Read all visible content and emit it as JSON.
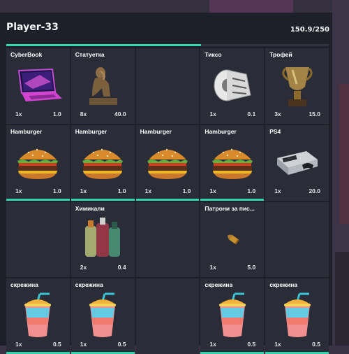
{
  "inventory": {
    "title": "Player-33",
    "weight_text": "150.9/250",
    "weight_fraction": 0.6036
  },
  "colors": {
    "accent": "#30d9b2",
    "slot": "#2a2d38",
    "panel": "#1e2029"
  },
  "slots": [
    {
      "name": "CyberBook",
      "count": "1x",
      "weight": "1.0",
      "icon": "laptop-icon",
      "bar": false
    },
    {
      "name": "Статуетка",
      "count": "8x",
      "weight": "40.0",
      "icon": "statue-icon",
      "bar": false
    },
    {
      "name": "",
      "count": "",
      "weight": "",
      "icon": "",
      "bar": false
    },
    {
      "name": "Тиксо",
      "count": "1x",
      "weight": "0.1",
      "icon": "tape-icon",
      "bar": false
    },
    {
      "name": "Трофей",
      "count": "3x",
      "weight": "15.0",
      "icon": "trophy-icon",
      "bar": false
    },
    {
      "name": "Hamburger",
      "count": "1x",
      "weight": "1.0",
      "icon": "burger-icon",
      "bar": true
    },
    {
      "name": "Hamburger",
      "count": "1x",
      "weight": "1.0",
      "icon": "burger-icon",
      "bar": true
    },
    {
      "name": "Hamburger",
      "count": "1x",
      "weight": "1.0",
      "icon": "burger-icon",
      "bar": true
    },
    {
      "name": "Hamburger",
      "count": "1x",
      "weight": "1.0",
      "icon": "burger-icon",
      "bar": true
    },
    {
      "name": "PS4",
      "count": "1x",
      "weight": "20.0",
      "icon": "console-icon",
      "bar": false
    },
    {
      "name": "",
      "count": "",
      "weight": "",
      "icon": "",
      "bar": false
    },
    {
      "name": "Химикали",
      "count": "2x",
      "weight": "0.4",
      "icon": "chemicals-icon",
      "bar": false
    },
    {
      "name": "",
      "count": "",
      "weight": "",
      "icon": "",
      "bar": false
    },
    {
      "name": "Патрони за пис...",
      "count": "1x",
      "weight": "5.0",
      "icon": "bullet-icon",
      "bar": false
    },
    {
      "name": "",
      "count": "",
      "weight": "",
      "icon": "",
      "bar": false
    },
    {
      "name": "скрежина",
      "count": "1x",
      "weight": "0.5",
      "icon": "slushie-icon",
      "bar": true
    },
    {
      "name": "скрежина",
      "count": "1x",
      "weight": "0.5",
      "icon": "slushie-icon",
      "bar": true
    },
    {
      "name": "",
      "count": "",
      "weight": "",
      "icon": "",
      "bar": false
    },
    {
      "name": "скрежина",
      "count": "1x",
      "weight": "0.5",
      "icon": "slushie-icon",
      "bar": true
    },
    {
      "name": "скрежина",
      "count": "1x",
      "weight": "0.5",
      "icon": "slushie-icon",
      "bar": true
    }
  ]
}
